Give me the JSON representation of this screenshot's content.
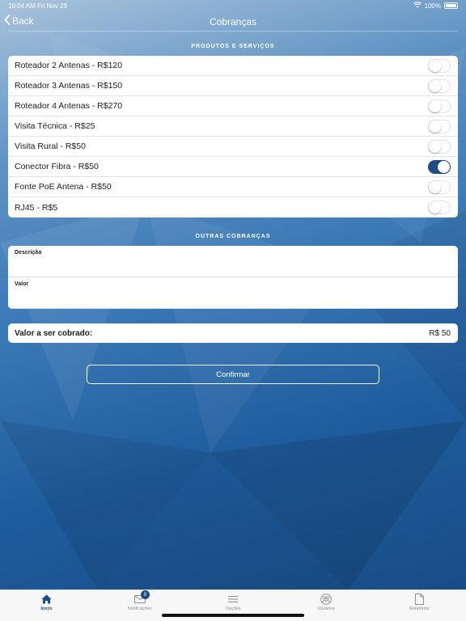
{
  "status_bar": {
    "time": "10:04 AM",
    "date": "Fri Nov 29",
    "battery": "100%"
  },
  "nav": {
    "back_label": "Back",
    "title": "Cobranças"
  },
  "products_section": {
    "header": "PRODUTOS E SERVIÇOS",
    "items": [
      {
        "label": "Roteador 2 Antenas - R$120",
        "on": false
      },
      {
        "label": "Roteador 3 Antenas - R$150",
        "on": false
      },
      {
        "label": "Roteador 4 Antenas - R$270",
        "on": false
      },
      {
        "label": "Visita Técnica - R$25",
        "on": false
      },
      {
        "label": "Visita Rural - R$50",
        "on": false
      },
      {
        "label": "Conector Fibra - R$50",
        "on": true
      },
      {
        "label": "Fonte PoE Antena - R$50",
        "on": false
      },
      {
        "label": "RJ45 - R$5",
        "on": false
      }
    ]
  },
  "other_section": {
    "header": "OUTRAS COBRANÇAS",
    "description_label": "Descrição",
    "description_value": "",
    "value_label": "Valor",
    "value_value": ""
  },
  "total": {
    "label": "Valor a ser cobrado:",
    "value": "R$ 50"
  },
  "confirm_label": "Confirmar",
  "colors": {
    "accent": "#1d4d86",
    "background_top": "#a9c3dc",
    "background_bottom": "#174a82"
  },
  "tab_bar": {
    "tabs": [
      {
        "label": "Início",
        "icon": "home-icon",
        "active": true
      },
      {
        "label": "Notificações",
        "icon": "envelope-icon",
        "badge": "9"
      },
      {
        "label": "Opções",
        "icon": "menu-icon"
      },
      {
        "label": "Usuários",
        "icon": "users-icon"
      },
      {
        "label": "Relatórios",
        "icon": "document-icon"
      }
    ]
  }
}
